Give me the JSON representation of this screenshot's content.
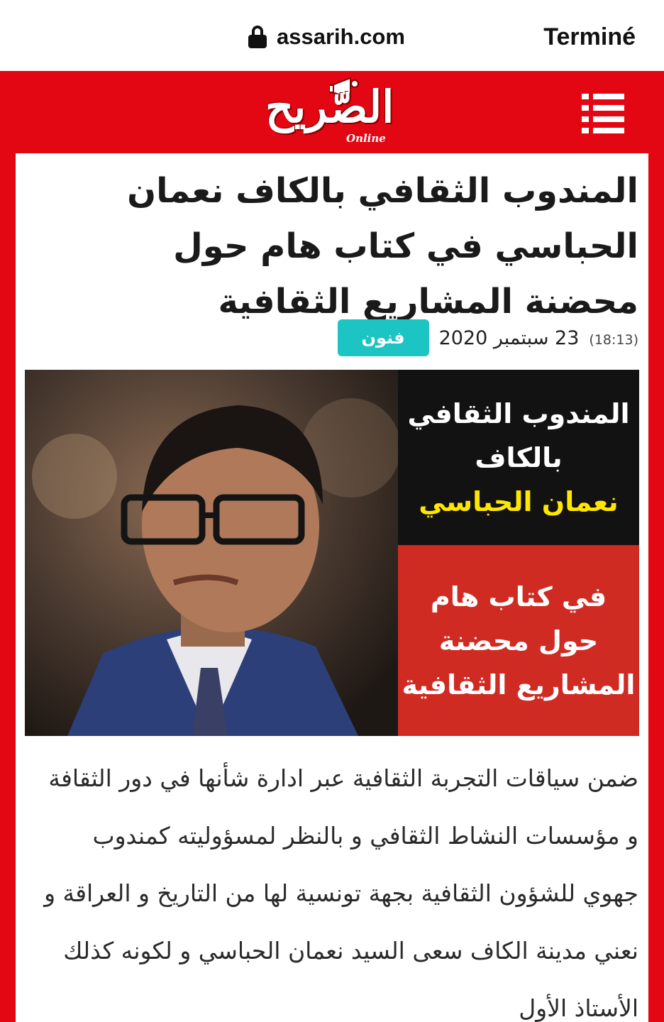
{
  "browser": {
    "url": "assarih.com",
    "done_label": "Terminé",
    "lock_icon": "lock-icon"
  },
  "site": {
    "logo_text": "الصّريح",
    "logo_sub": "Online",
    "menu_icon": "hamburger-menu-icon",
    "brand_color": "#e30613"
  },
  "article": {
    "headline": "المندوب الثقافي بالكاف نعمان الحباسي في كتاب هام حول محضنة المشاريع الثقافية",
    "category": "فنون",
    "category_color": "#1cc4c4",
    "date": "23 سبتمبر 2020",
    "time": "(18:13)",
    "image": {
      "caption_top": [
        "المندوب الثقافي",
        "بالكاف"
      ],
      "caption_name": "نعمان الحباسي",
      "caption_bottom": [
        "في كتاب هام",
        "حول محضنة",
        "المشاريع الثقافية"
      ]
    },
    "body": "ضمن سياقات التجربة الثقافية عبر ادارة شأنها في دور الثقافة و مؤسسات النشاط الثقافي و بالنظر لمسؤوليته كمندوب جهوي للشؤون الثقافية بجهة تونسية لها من التاريخ و العراقة و نعني مدينة الكاف سعى السيد نعمان الحباسي و لكونه كذلك الأستاذ الأول"
  }
}
